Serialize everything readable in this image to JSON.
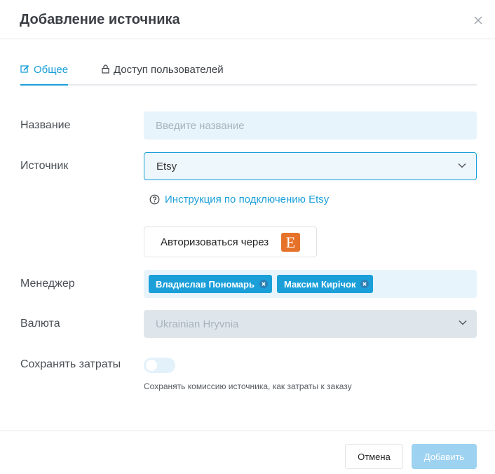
{
  "dialog": {
    "title": "Добавление источника"
  },
  "tabs": [
    {
      "label": "Общее",
      "icon": "edit-icon",
      "active": true
    },
    {
      "label": "Доступ пользователей",
      "icon": "lock-icon",
      "active": false
    }
  ],
  "form": {
    "name": {
      "label": "Название",
      "placeholder": "Введите название",
      "value": ""
    },
    "source": {
      "label": "Источник",
      "value": "Etsy",
      "help_text": "Инструкция по подключению Etsy"
    },
    "auth": {
      "label": "Авторизоваться через",
      "logo_letter": "E"
    },
    "manager": {
      "label": "Менеджер",
      "chips": [
        "Владислав Пономарь",
        "Максим Кирічок"
      ]
    },
    "currency": {
      "label": "Валюта",
      "value": "Ukrainian Hryvnia"
    },
    "save_costs": {
      "label": "Сохранять затраты",
      "enabled": false,
      "hint": "Сохранять комиссию источника, как затраты к заказу"
    }
  },
  "footer": {
    "cancel_label": "Отмена",
    "add_label": "Добавить"
  },
  "colors": {
    "accent": "#1a9fd9",
    "input_bg": "#e8f4fb",
    "etsy_orange": "#e6722a",
    "disabled_button": "#9ed2f1"
  }
}
